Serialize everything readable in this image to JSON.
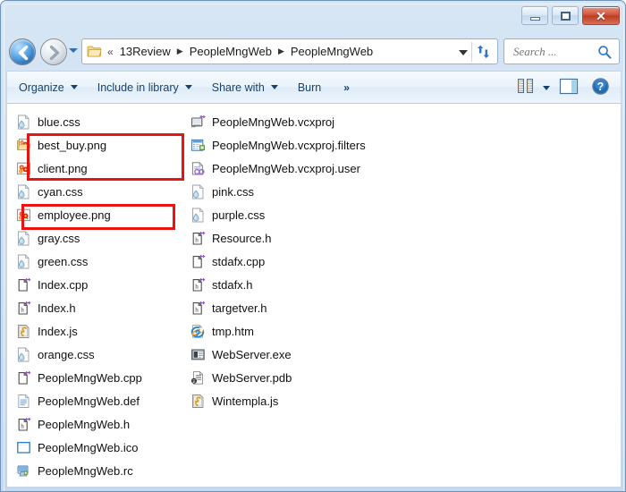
{
  "window": {
    "frame_color": "#c4d8ee",
    "controls": [
      {
        "name": "minimize",
        "glyph": "minimize-glyph"
      },
      {
        "name": "maximize",
        "glyph": "maximize-glyph"
      },
      {
        "name": "close",
        "glyph": "✕"
      }
    ]
  },
  "navigation": {
    "back_label": "Back",
    "forward_label": "Forward",
    "recent_pages_label": "Recent pages",
    "breadcrumb": {
      "overflow": "«",
      "separator": "▶",
      "items": [
        "13Review",
        "PeopleMngWeb",
        "PeopleMngWeb"
      ]
    },
    "refresh_label": "Refresh"
  },
  "search": {
    "placeholder": "Search ...",
    "value": "",
    "icon": "search-icon"
  },
  "toolbar": {
    "items": [
      {
        "label": "Organize",
        "has_caret": true
      },
      {
        "label": "Include in library",
        "has_caret": true
      },
      {
        "label": "Share with",
        "has_caret": true
      },
      {
        "label": "Burn",
        "has_caret": false
      }
    ],
    "overflow_label": "»",
    "views_label": "Change your view",
    "preview_label": "Show the preview pane",
    "help_label": "Get help",
    "help_glyph": "?"
  },
  "files": {
    "column1": [
      {
        "name": "blue.css",
        "icon": "css-file-icon"
      },
      {
        "name": "best_buy.png",
        "icon": "png-image-icon"
      },
      {
        "name": "client.png",
        "icon": "png-image-icon"
      },
      {
        "name": "cyan.css",
        "icon": "css-file-icon"
      },
      {
        "name": "employee.png",
        "icon": "png-image-icon"
      },
      {
        "name": "gray.css",
        "icon": "css-file-icon"
      },
      {
        "name": "green.css",
        "icon": "css-file-icon"
      },
      {
        "name": "Index.cpp",
        "icon": "cpp-file-icon"
      },
      {
        "name": "Index.h",
        "icon": "header-file-icon"
      },
      {
        "name": "Index.js",
        "icon": "js-script-icon"
      },
      {
        "name": "orange.css",
        "icon": "css-file-icon"
      },
      {
        "name": "PeopleMngWeb.cpp",
        "icon": "cpp-file-icon"
      },
      {
        "name": "PeopleMngWeb.def",
        "icon": "text-file-icon"
      },
      {
        "name": "PeopleMngWeb.h",
        "icon": "header-file-icon"
      },
      {
        "name": "PeopleMngWeb.ico",
        "icon": "ico-file-icon"
      },
      {
        "name": "PeopleMngWeb.rc",
        "icon": "resource-file-icon"
      }
    ],
    "column2": [
      {
        "name": "PeopleMngWeb.vcxproj",
        "icon": "vcxproj-file-icon"
      },
      {
        "name": "PeopleMngWeb.vcxproj.filters",
        "icon": "vcxproj-filters-icon"
      },
      {
        "name": "PeopleMngWeb.vcxproj.user",
        "icon": "vcxproj-user-icon"
      },
      {
        "name": "pink.css",
        "icon": "css-file-icon"
      },
      {
        "name": "purple.css",
        "icon": "css-file-icon"
      },
      {
        "name": "Resource.h",
        "icon": "header-file-icon"
      },
      {
        "name": "stdafx.cpp",
        "icon": "cpp-file-icon"
      },
      {
        "name": "stdafx.h",
        "icon": "header-file-icon"
      },
      {
        "name": "targetver.h",
        "icon": "header-file-icon"
      },
      {
        "name": "tmp.htm",
        "icon": "html-file-icon"
      },
      {
        "name": "WebServer.exe",
        "icon": "exe-file-icon"
      },
      {
        "name": "WebServer.pdb",
        "icon": "pdb-file-icon"
      },
      {
        "name": "Wintempla.js",
        "icon": "js-script-icon"
      }
    ]
  },
  "annotations": {
    "highlight_color": "#e81414",
    "boxes": [
      {
        "label": "highlight-png-pair"
      },
      {
        "label": "highlight-employee-png"
      }
    ]
  }
}
